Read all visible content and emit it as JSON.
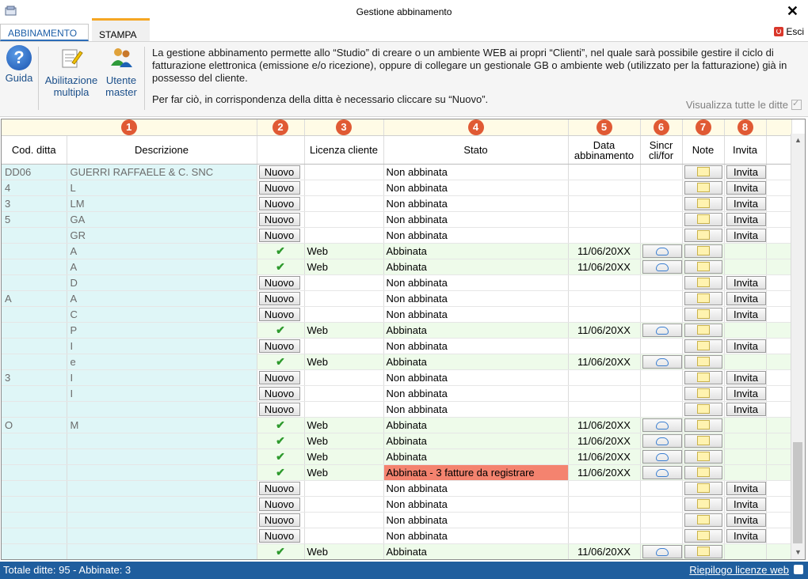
{
  "window": {
    "title": "Gestione abbinamento"
  },
  "tabs": [
    {
      "label": "ABBINAMENTO"
    },
    {
      "label": "STAMPA"
    }
  ],
  "exit_label": "Esci",
  "ribbon": {
    "buttons": [
      {
        "label1": "Guida",
        "label2": ""
      },
      {
        "label1": "Abilitazione",
        "label2": "multipla"
      },
      {
        "label1": "Utente",
        "label2": "master"
      }
    ],
    "description_1": "La gestione abbinamento permette allo “Studio” di creare o un ambiente WEB ai propri “Clienti”, nel quale sarà possibile gestire il ciclo di fatturazione elettronica (emissione e/o ricezione), oppure di collegare un gestionale GB o ambiente web (utilizzato per la fatturazione) già in possesso del cliente.",
    "description_2": "Per far ciò, in corrispondenza della ditta è necessario cliccare su “Nuovo”.",
    "show_all_label": "Visualizza tutte le ditte",
    "show_all_checked": true
  },
  "grid": {
    "badges": [
      "1",
      "2",
      "3",
      "4",
      "5",
      "6",
      "7",
      "8"
    ],
    "headers": {
      "cod": "Cod. ditta",
      "desc": "Descrizione",
      "lic": "Licenza cliente",
      "stato": "Stato",
      "data1": "Data",
      "data2": "abbinamento",
      "sync1": "Sincr",
      "sync2": "cli/for",
      "note": "Note",
      "invita": "Invita"
    },
    "labels": {
      "nuovo": "Nuovo",
      "invita": "Invita"
    },
    "rows": [
      {
        "cod": "DD06",
        "desc": "GUERRI RAFFAELE & C. SNC",
        "lic": "",
        "stato": "Non abbinata",
        "data": "",
        "abbinata": false,
        "warn": false
      },
      {
        "cod": "4",
        "desc": "L",
        "lic": "",
        "stato": "Non abbinata",
        "data": "",
        "abbinata": false,
        "warn": false
      },
      {
        "cod": "3",
        "desc": "LM",
        "lic": "",
        "stato": "Non abbinata",
        "data": "",
        "abbinata": false,
        "warn": false
      },
      {
        "cod": "5",
        "desc": "GA",
        "lic": "",
        "stato": "Non abbinata",
        "data": "",
        "abbinata": false,
        "warn": false
      },
      {
        "cod": "",
        "desc": "GR",
        "lic": "",
        "stato": "Non abbinata",
        "data": "",
        "abbinata": false,
        "warn": false
      },
      {
        "cod": "",
        "desc": "A",
        "lic": "Web",
        "stato": "Abbinata",
        "data": "11/06/20XX",
        "abbinata": true,
        "warn": false
      },
      {
        "cod": "",
        "desc": "A",
        "lic": "Web",
        "stato": "Abbinata",
        "data": "11/06/20XX",
        "abbinata": true,
        "warn": false
      },
      {
        "cod": "",
        "desc": "D",
        "lic": "",
        "stato": "Non abbinata",
        "data": "",
        "abbinata": false,
        "warn": false
      },
      {
        "cod": "A",
        "desc": "A",
        "lic": "",
        "stato": "Non abbinata",
        "data": "",
        "abbinata": false,
        "warn": false
      },
      {
        "cod": "",
        "desc": "C",
        "lic": "",
        "stato": "Non abbinata",
        "data": "",
        "abbinata": false,
        "warn": false
      },
      {
        "cod": "",
        "desc": "P",
        "lic": "Web",
        "stato": "Abbinata",
        "data": "11/06/20XX",
        "abbinata": true,
        "warn": false
      },
      {
        "cod": "",
        "desc": "I",
        "lic": "",
        "stato": "Non abbinata",
        "data": "",
        "abbinata": false,
        "warn": false
      },
      {
        "cod": "",
        "desc": "e",
        "lic": "Web",
        "stato": "Abbinata",
        "data": "11/06/20XX",
        "abbinata": true,
        "warn": false
      },
      {
        "cod": "3",
        "desc": "I",
        "lic": "",
        "stato": "Non abbinata",
        "data": "",
        "abbinata": false,
        "warn": false
      },
      {
        "cod": "",
        "desc": "I",
        "lic": "",
        "stato": "Non abbinata",
        "data": "",
        "abbinata": false,
        "warn": false
      },
      {
        "cod": "",
        "desc": "",
        "lic": "",
        "stato": "Non abbinata",
        "data": "",
        "abbinata": false,
        "warn": false
      },
      {
        "cod": "O",
        "desc": "M",
        "lic": "Web",
        "stato": "Abbinata",
        "data": "11/06/20XX",
        "abbinata": true,
        "warn": false
      },
      {
        "cod": "",
        "desc": "",
        "lic": "Web",
        "stato": "Abbinata",
        "data": "11/06/20XX",
        "abbinata": true,
        "warn": false
      },
      {
        "cod": "",
        "desc": "",
        "lic": "Web",
        "stato": "Abbinata",
        "data": "11/06/20XX",
        "abbinata": true,
        "warn": false
      },
      {
        "cod": "",
        "desc": "",
        "lic": "Web",
        "stato": "Abbinata - 3 fatture da registrare",
        "data": "11/06/20XX",
        "abbinata": true,
        "warn": true
      },
      {
        "cod": "",
        "desc": "",
        "lic": "",
        "stato": "Non abbinata",
        "data": "",
        "abbinata": false,
        "warn": false
      },
      {
        "cod": "",
        "desc": "",
        "lic": "",
        "stato": "Non abbinata",
        "data": "",
        "abbinata": false,
        "warn": false
      },
      {
        "cod": "",
        "desc": "",
        "lic": "",
        "stato": "Non abbinata",
        "data": "",
        "abbinata": false,
        "warn": false
      },
      {
        "cod": "",
        "desc": "",
        "lic": "",
        "stato": "Non abbinata",
        "data": "",
        "abbinata": false,
        "warn": false
      },
      {
        "cod": "",
        "desc": "",
        "lic": "Web",
        "stato": "Abbinata",
        "data": "11/06/20XX",
        "abbinata": true,
        "warn": false
      }
    ]
  },
  "status": {
    "totals": "Totale ditte: 95 - Abbinate: 3",
    "link": "Riepilogo licenze web"
  },
  "colors": {
    "accent": "#1f5e9e",
    "abbinata_row": "#eefbea",
    "warning": "#f4836f",
    "badge": "#e05a34"
  }
}
